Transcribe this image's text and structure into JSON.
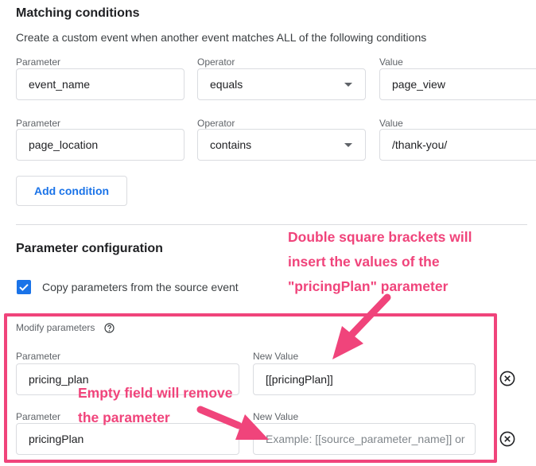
{
  "matching": {
    "title": "Matching conditions",
    "description": "Create a custom event when another event matches ALL of the following conditions",
    "conditions": [
      {
        "parameter_label": "Parameter",
        "parameter": "event_name",
        "operator_label": "Operator",
        "operator": "equals",
        "value_label": "Value",
        "value": "page_view"
      },
      {
        "parameter_label": "Parameter",
        "parameter": "page_location",
        "operator_label": "Operator",
        "operator": "contains",
        "value_label": "Value",
        "value": "/thank-you/"
      }
    ],
    "add_condition": "Add condition"
  },
  "param_config": {
    "title": "Parameter configuration",
    "copy_label": "Copy parameters from the source event",
    "copy_checked": true,
    "modify_label": "Modify parameters",
    "rows": [
      {
        "parameter_label": "Parameter",
        "parameter": "pricing_plan",
        "new_value_label": "New Value",
        "new_value": "[[pricingPlan]]",
        "new_value_placeholder": ""
      },
      {
        "parameter_label": "Parameter",
        "parameter": "pricingPlan",
        "new_value_label": "New Value",
        "new_value": "",
        "new_value_placeholder": "Example: [[source_parameter_name]] or"
      }
    ]
  },
  "annotations": {
    "top_lines": [
      "Double square brackets will",
      "insert the values of the",
      "\"pricingPlan\" parameter"
    ],
    "bottom_lines": [
      "Empty field will remove",
      "the parameter"
    ]
  },
  "colors": {
    "accent": "#1a73e8",
    "highlight": "#f0447b",
    "border": "#dadce0"
  }
}
